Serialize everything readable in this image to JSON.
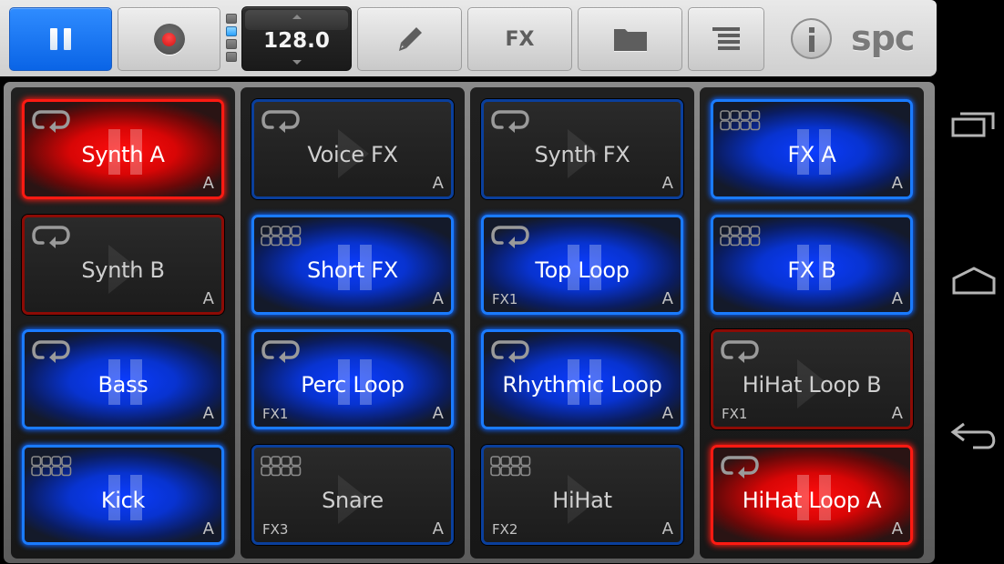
{
  "toolbar": {
    "play_button": {
      "state": "paused",
      "icon": "pause-icon"
    },
    "record_button": {
      "icon": "record-icon"
    },
    "bank_indicators": [
      {
        "active": false
      },
      {
        "active": true
      },
      {
        "active": false
      },
      {
        "active": false
      }
    ],
    "tempo": {
      "value": "128.0",
      "increase_icon": "arrow-up-icon",
      "decrease_icon": "arrow-down-icon"
    },
    "edit_button": {
      "icon": "pencil-icon"
    },
    "fx_button": {
      "label": "FX"
    },
    "folder_button": {
      "icon": "folder-icon"
    },
    "list_button": {
      "icon": "list-icon"
    },
    "info_button": {
      "icon": "info-icon"
    },
    "logo": "spc"
  },
  "colors": {
    "accent_blue": "#0a64e6",
    "playing_blue": "#0b3cff",
    "playing_red": "#ff0d0d",
    "idle_blue_border": "#0a3f9c",
    "idle_red_border": "#8c0b05",
    "toolbar_bg": "#dcdcdc"
  },
  "columns": [
    {
      "pads": [
        {
          "label": "Synth A",
          "bank": "A",
          "fx": "",
          "mode": "loop",
          "state": "playing",
          "color": "red"
        },
        {
          "label": "Synth B",
          "bank": "A",
          "fx": "",
          "mode": "loop",
          "state": "idle",
          "color": "red"
        },
        {
          "label": "Bass",
          "bank": "A",
          "fx": "",
          "mode": "loop",
          "state": "playing",
          "color": "blue"
        },
        {
          "label": "Kick",
          "bank": "A",
          "fx": "",
          "mode": "sequence",
          "state": "playing",
          "color": "blue"
        }
      ]
    },
    {
      "pads": [
        {
          "label": "Voice FX",
          "bank": "A",
          "fx": "",
          "mode": "loop",
          "state": "idle",
          "color": "blue"
        },
        {
          "label": "Short FX",
          "bank": "A",
          "fx": "",
          "mode": "sequence",
          "state": "playing",
          "color": "blue"
        },
        {
          "label": "Perc Loop",
          "bank": "A",
          "fx": "FX1",
          "mode": "loop",
          "state": "playing",
          "color": "blue"
        },
        {
          "label": "Snare",
          "bank": "A",
          "fx": "FX3",
          "mode": "sequence",
          "state": "idle",
          "color": "blue"
        }
      ]
    },
    {
      "pads": [
        {
          "label": "Synth FX",
          "bank": "A",
          "fx": "",
          "mode": "loop",
          "state": "idle",
          "color": "blue"
        },
        {
          "label": "Top Loop",
          "bank": "A",
          "fx": "FX1",
          "mode": "loop",
          "state": "playing",
          "color": "blue"
        },
        {
          "label": "Rhythmic Loop",
          "bank": "A",
          "fx": "",
          "mode": "loop",
          "state": "playing",
          "color": "blue"
        },
        {
          "label": "HiHat",
          "bank": "A",
          "fx": "FX2",
          "mode": "sequence",
          "state": "idle",
          "color": "blue"
        }
      ]
    },
    {
      "pads": [
        {
          "label": "FX A",
          "bank": "A",
          "fx": "",
          "mode": "sequence",
          "state": "playing",
          "color": "blue"
        },
        {
          "label": "FX B",
          "bank": "A",
          "fx": "",
          "mode": "sequence",
          "state": "playing",
          "color": "blue"
        },
        {
          "label": "HiHat Loop B",
          "bank": "A",
          "fx": "FX1",
          "mode": "loop",
          "state": "idle",
          "color": "red"
        },
        {
          "label": "HiHat Loop A",
          "bank": "A",
          "fx": "",
          "mode": "loop",
          "state": "playing",
          "color": "red"
        }
      ]
    }
  ],
  "navbar": {
    "recents_icon": "recent-apps-icon",
    "home_icon": "home-icon",
    "back_icon": "back-icon"
  }
}
